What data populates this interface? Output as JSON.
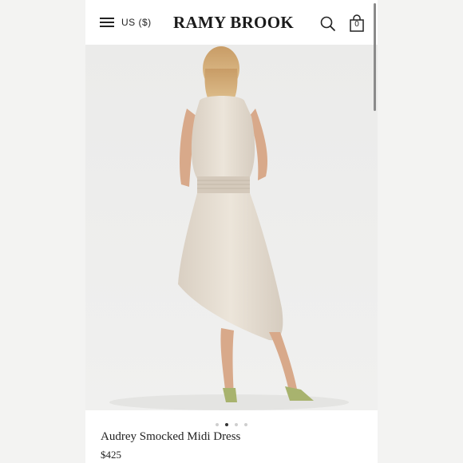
{
  "header": {
    "currency_label": "US ($)",
    "brand": "RAMY BROOK",
    "bag_count": "0",
    "icons": [
      "menu-icon",
      "search-icon",
      "bag-icon"
    ]
  },
  "gallery": {
    "image_description": "model-back-view",
    "slide_count": 4,
    "active_slide": 2
  },
  "product": {
    "name": "Audrey Smocked Midi Dress",
    "price": "$425"
  },
  "colors": {
    "dress": "#e6ddd1",
    "background": "#ffffff",
    "text": "#222222"
  }
}
